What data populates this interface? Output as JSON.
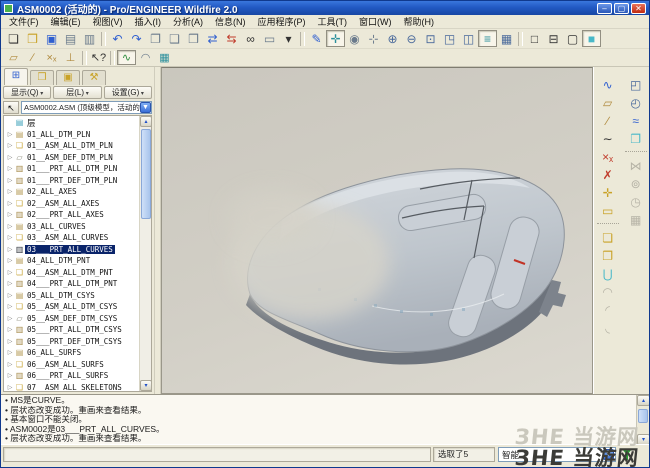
{
  "window": {
    "title": "ASM0002 (活动的) - Pro/ENGINEER Wildfire 2.0"
  },
  "colors": {
    "titlebar_blue": "#2259c4",
    "selection_navy": "#0a246a",
    "canvas_gray": "#cfccc3",
    "toolbar_beige": "#ece9d8"
  },
  "menu_items": [
    {
      "name": "menu-file",
      "label": "文件(F)"
    },
    {
      "name": "menu-edit",
      "label": "编辑(E)"
    },
    {
      "name": "menu-view",
      "label": "视图(V)"
    },
    {
      "name": "menu-insert",
      "label": "插入(I)"
    },
    {
      "name": "menu-analysis",
      "label": "分析(A)"
    },
    {
      "name": "menu-info",
      "label": "信息(N)"
    },
    {
      "name": "menu-applications",
      "label": "应用程序(P)"
    },
    {
      "name": "menu-tools",
      "label": "工具(T)"
    },
    {
      "name": "menu-window",
      "label": "窗口(W)"
    },
    {
      "name": "menu-help",
      "label": "帮助(H)"
    }
  ],
  "toolbar_main": [
    {
      "name": "new-file-button",
      "glyph": "❏",
      "tone": "ink"
    },
    {
      "name": "open-file-button",
      "glyph": "❒",
      "tone": "gold"
    },
    {
      "name": "save-file-button",
      "glyph": "▣",
      "tone": "blue"
    },
    {
      "name": "print-button",
      "glyph": "▤",
      "tone": "slate"
    },
    {
      "name": "print-preview-button",
      "glyph": "▥",
      "tone": "slate"
    },
    {
      "name": "separator",
      "sep": "true",
      "interactable": "false"
    },
    {
      "name": "undo-button",
      "glyph": "↶",
      "tone": "blue"
    },
    {
      "name": "redo-button",
      "glyph": "↷",
      "tone": "blue"
    },
    {
      "name": "copy-button",
      "glyph": "❐",
      "tone": "slate"
    },
    {
      "name": "paste-button",
      "glyph": "❑",
      "tone": "slate"
    },
    {
      "name": "paste-special-button",
      "glyph": "❒",
      "tone": "slate"
    },
    {
      "name": "regenerate-button",
      "glyph": "⇄",
      "tone": "blue"
    },
    {
      "name": "regenerate-custom-button",
      "glyph": "⇆",
      "tone": "red"
    },
    {
      "name": "find-button",
      "glyph": "∞",
      "tone": "ink"
    },
    {
      "name": "select-box-button",
      "glyph": "▭",
      "tone": "slate"
    },
    {
      "name": "select-options-caret",
      "glyph": "▾",
      "tone": "ink"
    },
    {
      "name": "separator",
      "sep": "true",
      "interactable": "false"
    },
    {
      "name": "repaint-button",
      "glyph": "✎",
      "tone": "blue"
    },
    {
      "name": "spin-center-button",
      "glyph": "✛",
      "tone": "teal",
      "pressed": "true"
    },
    {
      "name": "orient-mode-button",
      "glyph": "◉",
      "tone": "slate"
    },
    {
      "name": "pan-zoom-button",
      "glyph": "⊹",
      "tone": "slate"
    },
    {
      "name": "zoom-in-button",
      "glyph": "⊕",
      "tone": "steel"
    },
    {
      "name": "zoom-out-button",
      "glyph": "⊖",
      "tone": "steel"
    },
    {
      "name": "refit-button",
      "glyph": "⊡",
      "tone": "steel"
    },
    {
      "name": "reorient-button",
      "glyph": "◳",
      "tone": "steel"
    },
    {
      "name": "view-manager-button",
      "glyph": "◫",
      "tone": "steel"
    },
    {
      "name": "layers-button",
      "glyph": "≡",
      "tone": "teal",
      "pressed": "true"
    },
    {
      "name": "saved-views-button",
      "glyph": "▦",
      "tone": "steel"
    },
    {
      "name": "separator",
      "sep": "true",
      "interactable": "false"
    },
    {
      "name": "wireframe-button",
      "glyph": "□",
      "tone": "ink"
    },
    {
      "name": "hidden-line-button",
      "glyph": "⊟",
      "tone": "ink"
    },
    {
      "name": "no-hidden-button",
      "glyph": "▢",
      "tone": "ink"
    },
    {
      "name": "shaded-button",
      "glyph": "■",
      "tone": "cyan",
      "pressed": "true"
    }
  ],
  "toolbar_datum": [
    {
      "name": "datum-plane-toggle",
      "glyph": "▱",
      "tone": "tan"
    },
    {
      "name": "datum-axis-toggle",
      "glyph": "∕",
      "tone": "tan"
    },
    {
      "name": "datum-point-toggle",
      "glyph": "×ₓ",
      "tone": "tan"
    },
    {
      "name": "csys-display-toggle",
      "glyph": "⊥",
      "tone": "tan"
    },
    {
      "name": "separator",
      "sep": "true",
      "interactable": "false"
    },
    {
      "name": "context-help-button",
      "glyph": "↖?",
      "tone": "ink"
    },
    {
      "name": "separator",
      "sep": "true",
      "interactable": "false"
    },
    {
      "name": "curve-tool-button",
      "glyph": "∿",
      "tone": "green",
      "pressed": "true"
    },
    {
      "name": "pipe-tool-button",
      "glyph": "◠",
      "tone": "slate"
    },
    {
      "name": "misc-tool-button",
      "glyph": "▦",
      "tone": "teal"
    }
  ],
  "navigator": {
    "tabs": [
      {
        "name": "tab-model-tree",
        "glyph": "⊞",
        "tone": "blue",
        "active": "true"
      },
      {
        "name": "tab-folder-browser",
        "glyph": "❒",
        "tone": "gold"
      },
      {
        "name": "tab-favorites",
        "glyph": "▣",
        "tone": "gold"
      },
      {
        "name": "tab-connections",
        "glyph": "⚒",
        "tone": "gold"
      }
    ],
    "buttons": [
      {
        "name": "show-menu-button",
        "label": "显示(Q)"
      },
      {
        "name": "layer-menu-button",
        "label": "层(L)"
      },
      {
        "name": "settings-menu-button",
        "label": "设置(G)"
      }
    ],
    "selector_value": "ASM0002.ASM (顶级模型，活动的)",
    "tree_root": "层",
    "tree_items": [
      {
        "label": "01_ALL_DTM_PLN",
        "icon": "stack"
      },
      {
        "label": "01__ASM_ALL_DTM_PLN",
        "icon": "note"
      },
      {
        "label": "01__ASM_DEF_DTM_PLN",
        "icon": "plane"
      },
      {
        "label": "01___PRT_ALL_DTM_PLN",
        "icon": "book"
      },
      {
        "label": "01___PRT_DEF_DTM_PLN",
        "icon": "book"
      },
      {
        "label": "02_ALL_AXES",
        "icon": "stack"
      },
      {
        "label": "02__ASM_ALL_AXES",
        "icon": "note"
      },
      {
        "label": "02___PRT_ALL_AXES",
        "icon": "book"
      },
      {
        "label": "03_ALL_CURVES",
        "icon": "stack"
      },
      {
        "label": "03__ASM_ALL_CURVES",
        "icon": "note"
      },
      {
        "label": "03___PRT_ALL_CURVES",
        "icon": "book",
        "selected": "true"
      },
      {
        "label": "04_ALL_DTM_PNT",
        "icon": "stack"
      },
      {
        "label": "04__ASM_ALL_DTM_PNT",
        "icon": "note"
      },
      {
        "label": "04___PRT_ALL_DTM_PNT",
        "icon": "book"
      },
      {
        "label": "05_ALL_DTM_CSYS",
        "icon": "stack"
      },
      {
        "label": "05__ASM_ALL_DTM_CSYS",
        "icon": "note"
      },
      {
        "label": "05__ASM_DEF_DTM_CSYS",
        "icon": "plane"
      },
      {
        "label": "05___PRT_ALL_DTM_CSYS",
        "icon": "book"
      },
      {
        "label": "05___PRT_DEF_DTM_CSYS",
        "icon": "book"
      },
      {
        "label": "06_ALL_SURFS",
        "icon": "stack"
      },
      {
        "label": "06__ASM_ALL_SURFS",
        "icon": "note"
      },
      {
        "label": "06___PRT_ALL_SURFS",
        "icon": "book"
      },
      {
        "label": "07__ASM_ALL_SKELETONS",
        "icon": "note"
      }
    ]
  },
  "right_toolbar": {
    "col_a": [
      {
        "name": "style-tool-button",
        "glyph": "∿",
        "tone": "blue"
      },
      {
        "name": "datum-plane-tool",
        "glyph": "▱",
        "tone": "tan"
      },
      {
        "name": "datum-axis-tool",
        "glyph": "∕",
        "tone": "tan"
      },
      {
        "name": "sketch-tool-button",
        "glyph": "∼",
        "tone": "ink"
      },
      {
        "name": "datum-point-tool",
        "glyph": "×ₓ",
        "tone": "red"
      },
      {
        "name": "offset-point-tool",
        "glyph": "✗",
        "tone": "red"
      },
      {
        "name": "csys-tool-button",
        "glyph": "✛",
        "tone": "gold"
      },
      {
        "name": "plan-view-tool",
        "glyph": "▭",
        "tone": "gold"
      },
      {
        "name": "separator",
        "sep": "true",
        "interactable": "false"
      },
      {
        "name": "copy-geometry-button",
        "glyph": "❏",
        "tone": "gold"
      },
      {
        "name": "publish-geometry-button",
        "glyph": "❐",
        "tone": "gold"
      },
      {
        "name": "merge-tool-button",
        "glyph": "⋃",
        "tone": "cyan"
      },
      {
        "name": "mirror-tool-button",
        "glyph": "◠",
        "disabled": "true"
      },
      {
        "name": "trim-tool-button",
        "glyph": "◜",
        "disabled": "true"
      },
      {
        "name": "extend-tool-button",
        "glyph": "◟",
        "disabled": "true"
      }
    ],
    "col_b": [
      {
        "name": "extrude-tool-button",
        "glyph": "◰",
        "tone": "steel"
      },
      {
        "name": "revolve-tool-button",
        "glyph": "◴",
        "tone": "steel"
      },
      {
        "name": "sweep-tool-button",
        "glyph": "≈",
        "tone": "blue"
      },
      {
        "name": "blend-tool-button",
        "glyph": "❐",
        "tone": "cyan"
      },
      {
        "name": "separator",
        "sep": "true",
        "interactable": "false"
      },
      {
        "name": "use-quilt-button",
        "glyph": "⋈",
        "disabled": "true"
      },
      {
        "name": "hole-tool-button",
        "glyph": "⊚",
        "disabled": "true"
      },
      {
        "name": "round-tool-button",
        "glyph": "◷",
        "disabled": "true"
      },
      {
        "name": "pattern-tool-button",
        "glyph": "▦",
        "disabled": "true"
      }
    ]
  },
  "messages": [
    "MS是CURVE。",
    "层状态改变成功。重画来查看结果。",
    "基本窗口不能关闭。",
    "ASM0002是03___PRT_ALL_CURVES。",
    "层状态改变成功。重画来查看结果。"
  ],
  "status": {
    "selected_count": "选取了5",
    "filter_value": "智能"
  },
  "watermark": {
    "text": "ЗНЕ 当游网"
  }
}
